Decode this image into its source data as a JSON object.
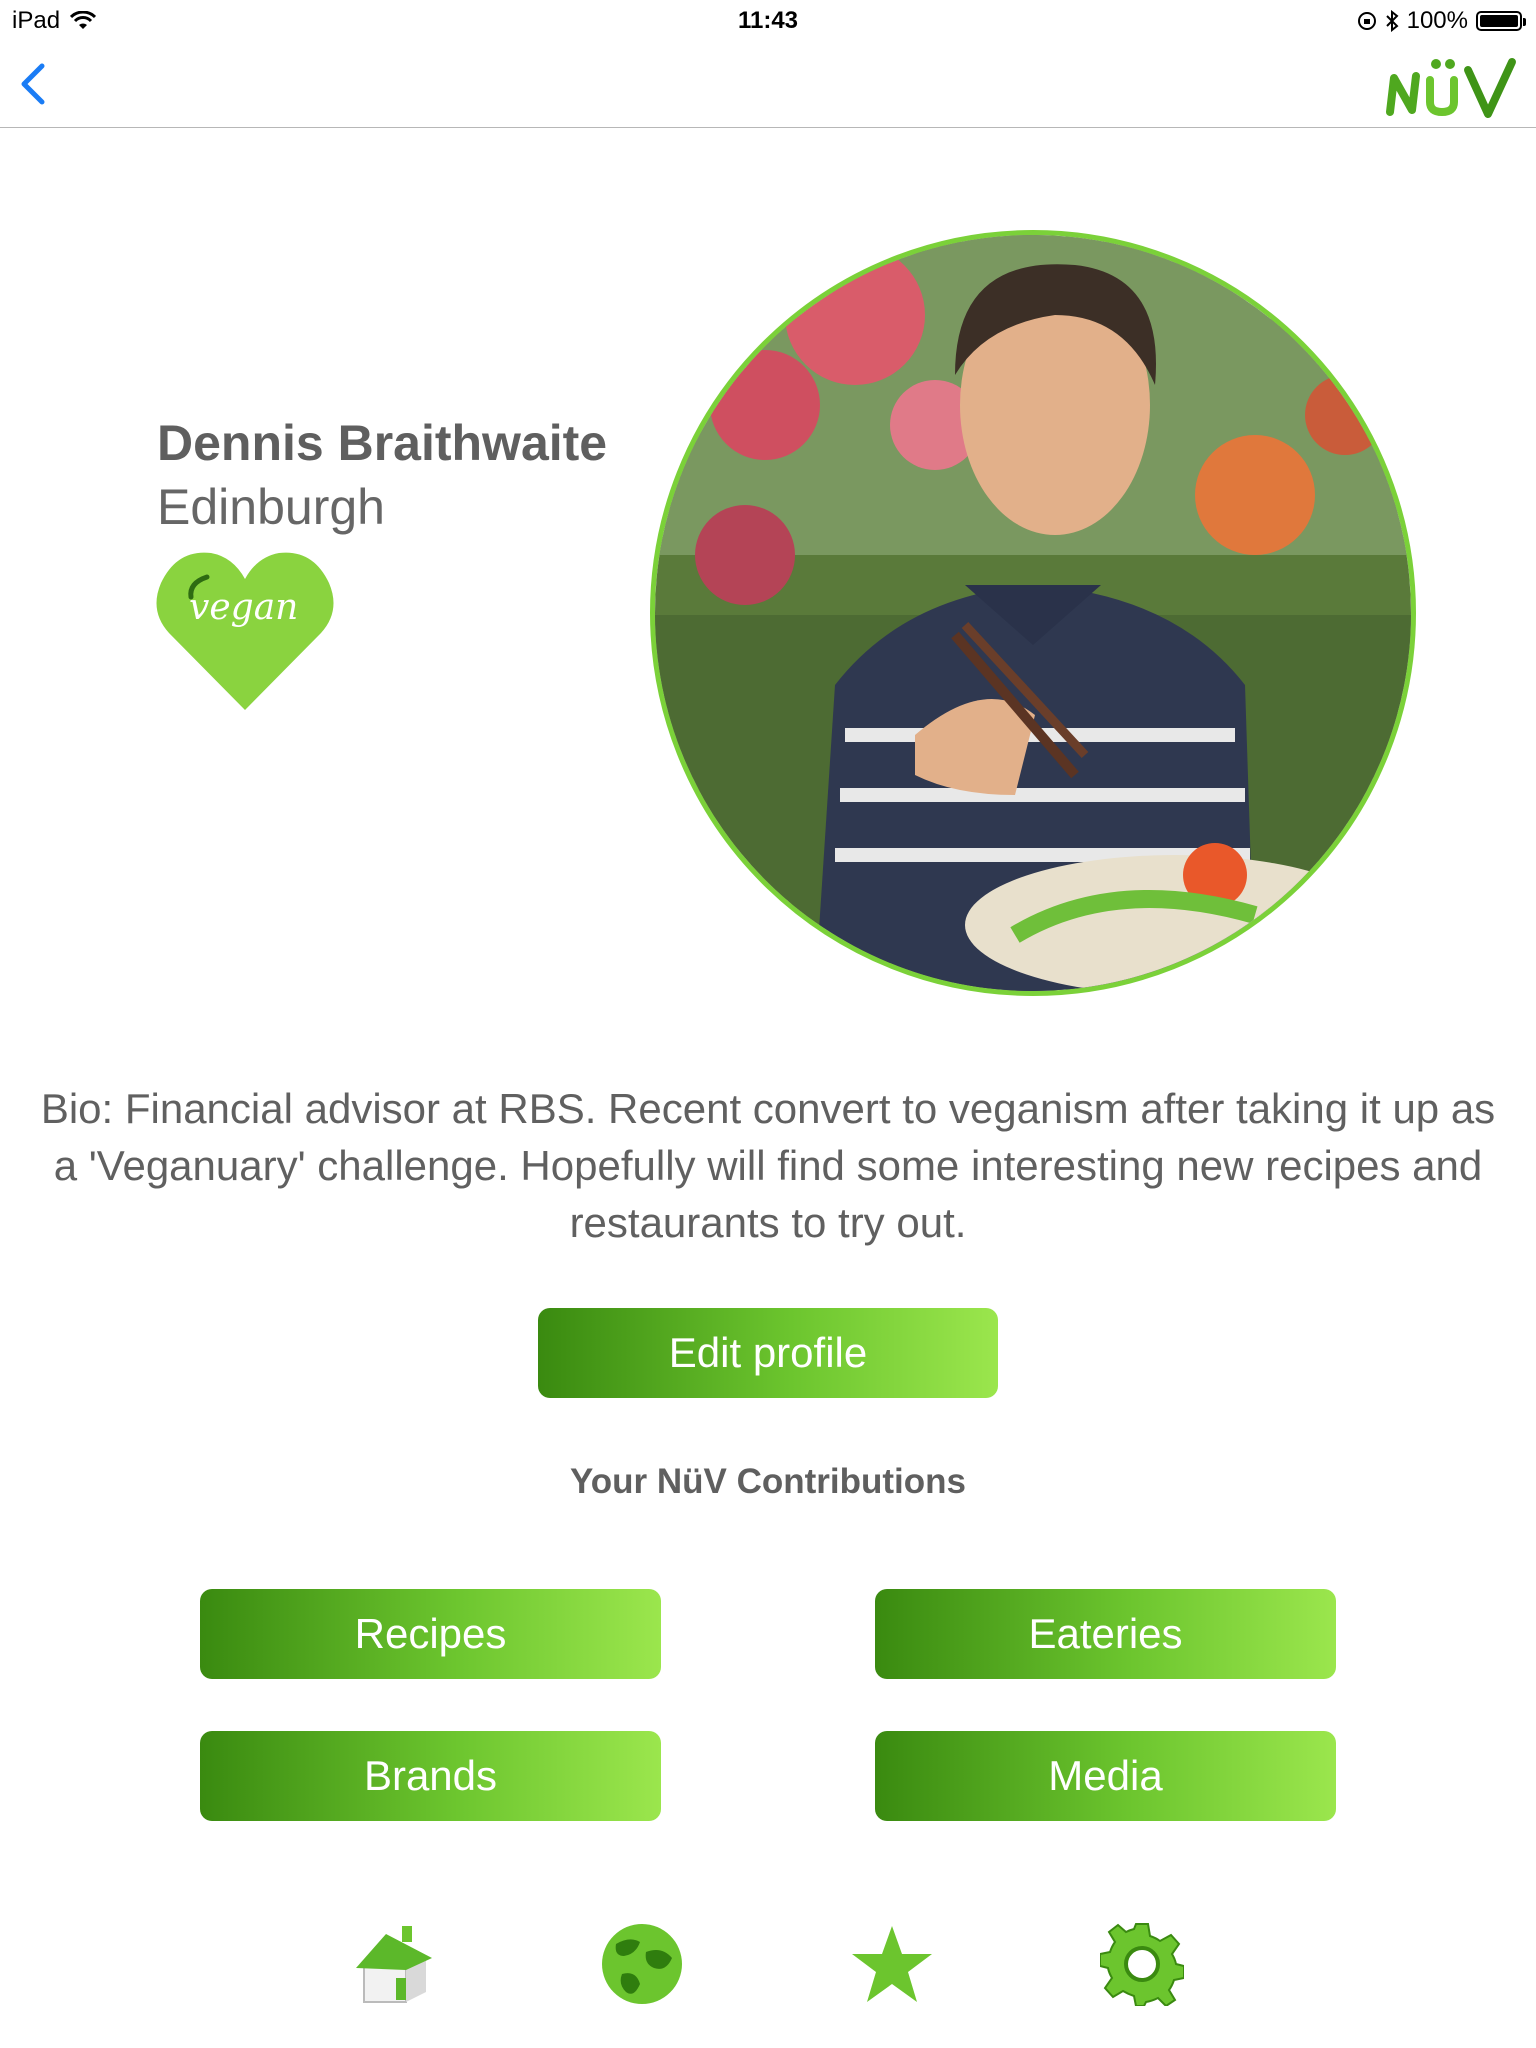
{
  "status_bar": {
    "device": "iPad",
    "time": "11:43",
    "battery": "100%",
    "battery_level": 1.0,
    "icons": [
      "wifi-icon",
      "orientation-lock-icon",
      "bluetooth-icon",
      "battery-icon"
    ]
  },
  "nav": {
    "back_icon": "chevron-left-icon",
    "logo_text": "NÜV"
  },
  "profile": {
    "name": "Dennis Braithwaite",
    "city": "Edinburgh",
    "badge_text": "vegan",
    "bio": "Bio: Financial advisor at RBS. Recent convert to veganism after taking it up as a 'Veganuary' challenge. Hopefully will find some interesting new recipes and restaurants to try out."
  },
  "actions": {
    "edit_profile": "Edit profile"
  },
  "contributions": {
    "title": "Your NüV Contributions",
    "buttons": [
      "Recipes",
      "Eateries",
      "Brands",
      "Media"
    ]
  },
  "tab_bar": {
    "items": [
      "home-icon",
      "globe-icon",
      "star-icon",
      "settings-gear-icon"
    ]
  },
  "colors": {
    "accent_green": "#6cc52e",
    "dark_green": "#3a8a10",
    "light_green": "#9be64d",
    "ios_blue": "#1a7cf5"
  }
}
